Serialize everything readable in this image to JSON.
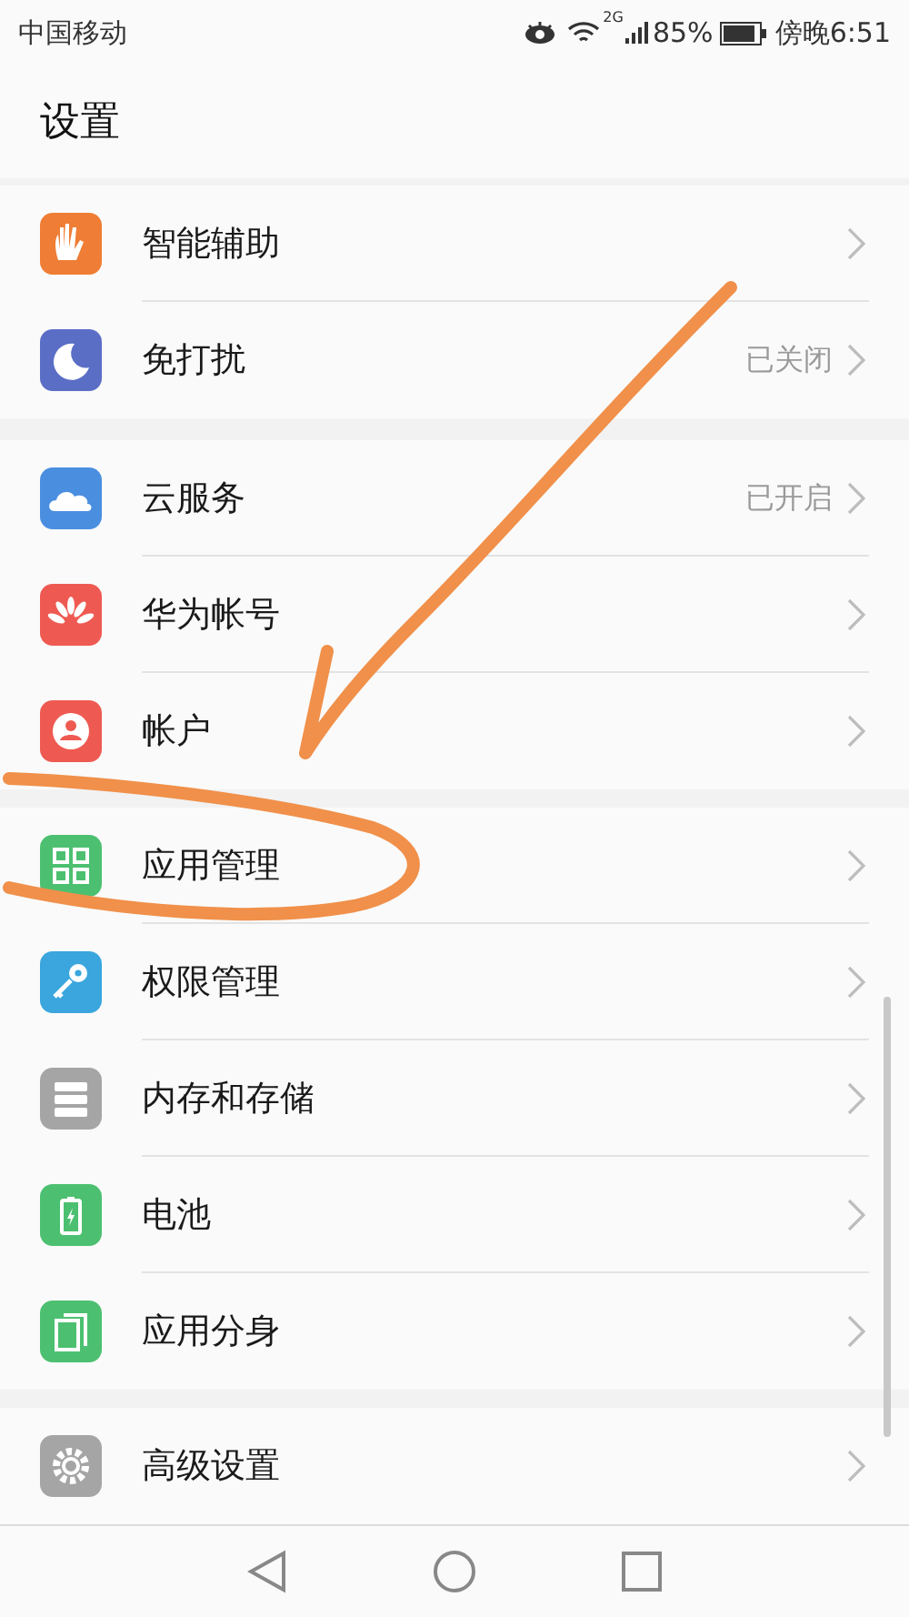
{
  "status_bar": {
    "carrier": "中国移动",
    "network": "2G",
    "battery": "85%",
    "time": "傍晚6:51"
  },
  "header": {
    "title": "设置"
  },
  "groups": [
    {
      "items": [
        {
          "label": "智能辅助",
          "color": "#ef7d35"
        },
        {
          "label": "免打扰",
          "value": "已关闭",
          "color": "#5b6ec6"
        }
      ]
    },
    {
      "items": [
        {
          "label": "云服务",
          "value": "已开启",
          "color": "#4a8ee0"
        },
        {
          "label": "华为帐号",
          "color": "#ee5a52"
        },
        {
          "label": "帐户",
          "color": "#ee5a52"
        }
      ]
    },
    {
      "items": [
        {
          "label": "应用管理",
          "color": "#4cc070"
        },
        {
          "label": "权限管理",
          "color": "#3aa6dd"
        },
        {
          "label": "内存和存储",
          "color": "#a5a5a5"
        },
        {
          "label": "电池",
          "color": "#4cc070"
        },
        {
          "label": "应用分身",
          "color": "#4cc070"
        }
      ]
    },
    {
      "items": [
        {
          "label": "高级设置",
          "color": "#a5a5a5"
        }
      ]
    }
  ]
}
